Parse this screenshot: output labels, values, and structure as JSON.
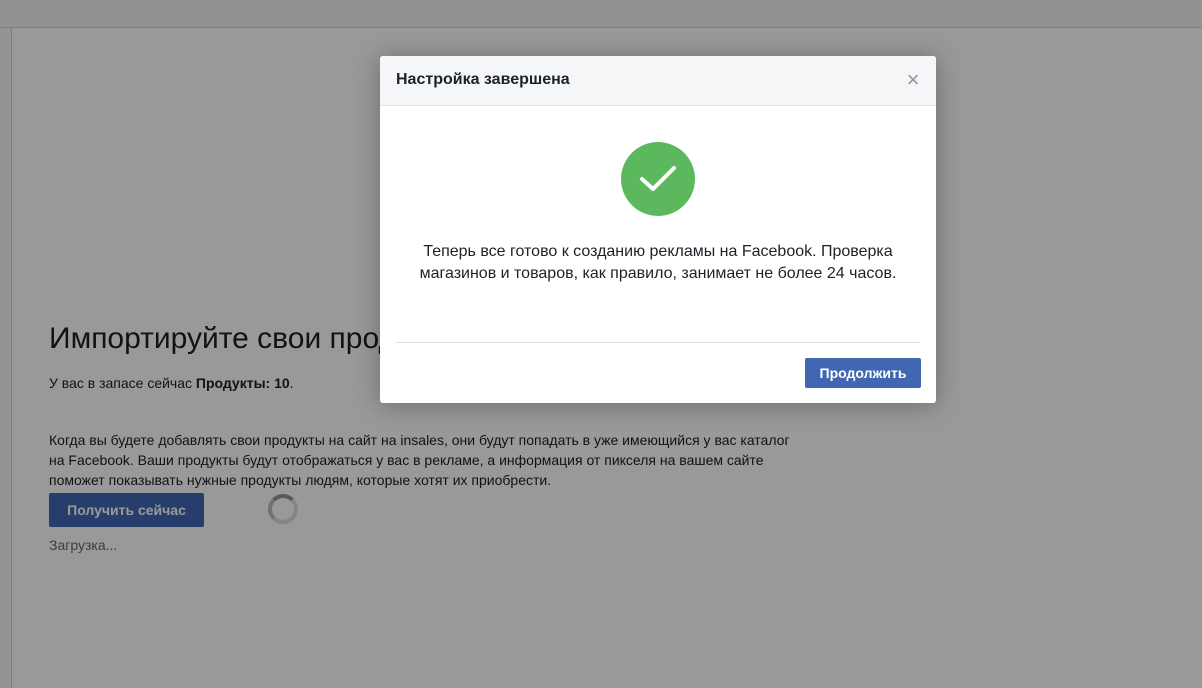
{
  "page": {
    "title": "Импортируйте свои продукты",
    "stock_prefix": "У вас в запасе сейчас ",
    "stock_bold": "Продукты: 10",
    "stock_suffix": ".",
    "description": "Когда вы будете добавлять свои продукты на сайт на insales, они будут попадать в уже имеющийся у вас каталог на Facebook. Ваши продукты будут отображаться у вас в рекламе, а информация от пикселя на вашем сайте поможет показывать нужные продукты людям, которые хотят их приобрести.",
    "get_button_label": "Получить сейчас",
    "loading_text": "Загрузка..."
  },
  "modal": {
    "title": "Настройка завершена",
    "close_symbol": "×",
    "message": "Теперь все готово к созданию рекламы на Facebook. Проверка магазинов и товаров, как правило, занимает не более 24 часов.",
    "continue_label": "Продолжить",
    "status_icon": "check-icon"
  },
  "colors": {
    "accent": "#4267b2",
    "success": "#5cb85c",
    "overlay": "rgba(0,0,0,0.4)"
  }
}
